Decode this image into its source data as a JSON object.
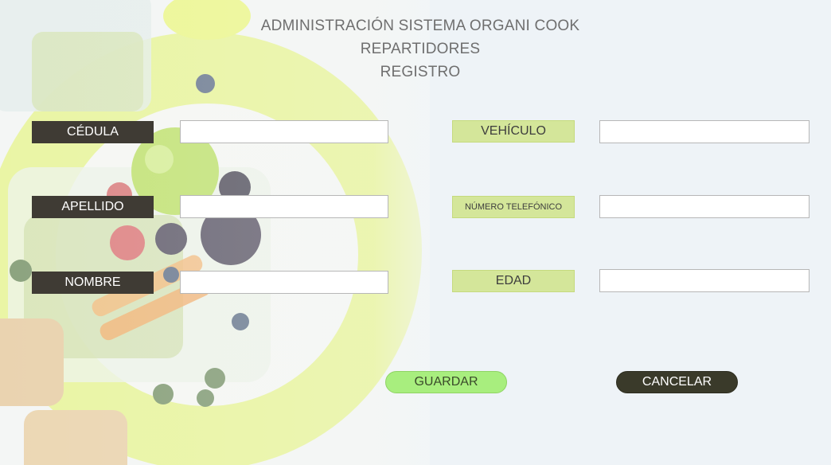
{
  "header": {
    "title": "ADMINISTRACIÓN SISTEMA ORGANI COOK",
    "section": "REPARTIDORES",
    "subsection": "REGISTRO"
  },
  "form": {
    "cedula": {
      "label": "CÉDULA",
      "value": ""
    },
    "apellido": {
      "label": "APELLIDO",
      "value": ""
    },
    "nombre": {
      "label": "NOMBRE",
      "value": ""
    },
    "vehiculo": {
      "label": "VEHÍCULO",
      "value": ""
    },
    "telefono": {
      "label": "NÚMERO TELEFÓNICO",
      "value": ""
    },
    "edad": {
      "label": "EDAD",
      "value": ""
    }
  },
  "actions": {
    "save_label": "GUARDAR",
    "cancel_label": "CANCELAR"
  },
  "colors": {
    "accent_green": "#d4e69a",
    "save_button": "#a8ee7e",
    "dark_label": "#3f3b34",
    "cancel_button": "#3a3a2a"
  }
}
